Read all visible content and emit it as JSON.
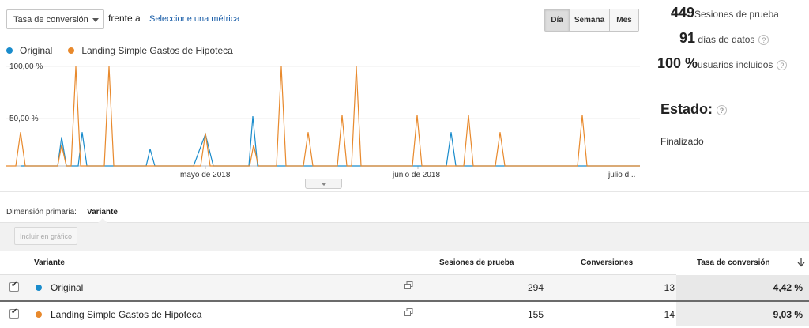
{
  "controls": {
    "metric_selected": "Tasa de conversión",
    "vs_label": "frente a",
    "choose_metric": "Seleccione una métrica",
    "periods": [
      "Día",
      "Semana",
      "Mes"
    ],
    "active_period": "Día"
  },
  "summary": {
    "sessions_value": "449",
    "sessions_label": "Sesiones de prueba",
    "days_value": "91",
    "days_label": "días de datos",
    "users_value": "100 %",
    "users_label": "usuarios incluidos",
    "status_label": "Estado:",
    "status_value": "Finalizado"
  },
  "dimension": {
    "label": "Dimensión primaria:",
    "value": "Variante",
    "plot_button": "Incluir en gráfico"
  },
  "table": {
    "headers": {
      "variant": "Variante",
      "sessions": "Sesiones de prueba",
      "conversions": "Conversiones",
      "rate": "Tasa de conversión"
    },
    "rows": [
      {
        "name": "Original",
        "sessions": "294",
        "conversions": "13",
        "rate": "4,42 %",
        "color": "#1a8ccc"
      },
      {
        "name": "Landing Simple Gastos de Hipoteca",
        "sessions": "155",
        "conversions": "14",
        "rate": "9,03 %",
        "color": "#e8892c"
      }
    ]
  },
  "chart_data": {
    "type": "line",
    "x_labels": [
      "mayo de 2018",
      "junio de 2018",
      "julio d..."
    ],
    "y_ticks": [
      "100,00 %",
      "50,00 %"
    ],
    "ylim": [
      0,
      100
    ],
    "series": [
      {
        "name": "Original",
        "color": "#1a8ccc",
        "points": [
          [
            26,
            0
          ],
          [
            73,
            0
          ],
          [
            78,
            29
          ],
          [
            84,
            0
          ],
          [
            99,
            0
          ],
          [
            104,
            34
          ],
          [
            110,
            0
          ],
          [
            148,
            0
          ],
          [
            185,
            0
          ],
          [
            190,
            17
          ],
          [
            196,
            0
          ],
          [
            245,
            0
          ],
          [
            260,
            32
          ],
          [
            270,
            0
          ],
          [
            315,
            0
          ],
          [
            320,
            50
          ],
          [
            326,
            0
          ],
          [
            565,
            0
          ],
          [
            571,
            34
          ],
          [
            577,
            0
          ],
          [
            810,
            0
          ]
        ]
      },
      {
        "name": "Landing Simple Gastos de Hipoteca",
        "color": "#e8892c",
        "points": [
          [
            8,
            0
          ],
          [
            20,
            0
          ],
          [
            26,
            34
          ],
          [
            32,
            0
          ],
          [
            73,
            0
          ],
          [
            78,
            21
          ],
          [
            84,
            0
          ],
          [
            90,
            0
          ],
          [
            96,
            100
          ],
          [
            102,
            0
          ],
          [
            132,
            0
          ],
          [
            138,
            100
          ],
          [
            144,
            0
          ],
          [
            254,
            0
          ],
          [
            260,
            33
          ],
          [
            266,
            0
          ],
          [
            316,
            0
          ],
          [
            321,
            21
          ],
          [
            327,
            0
          ],
          [
            350,
            0
          ],
          [
            356,
            100
          ],
          [
            362,
            0
          ],
          [
            384,
            0
          ],
          [
            390,
            34
          ],
          [
            396,
            0
          ],
          [
            427,
            0
          ],
          [
            433,
            51
          ],
          [
            439,
            0
          ],
          [
            445,
            0
          ],
          [
            451,
            100
          ],
          [
            457,
            0
          ],
          [
            522,
            0
          ],
          [
            528,
            51
          ],
          [
            534,
            0
          ],
          [
            587,
            0
          ],
          [
            593,
            51
          ],
          [
            599,
            0
          ],
          [
            627,
            0
          ],
          [
            633,
            34
          ],
          [
            639,
            0
          ],
          [
            731,
            0
          ],
          [
            737,
            51
          ],
          [
            743,
            0
          ],
          [
            810,
            0
          ]
        ]
      }
    ]
  }
}
